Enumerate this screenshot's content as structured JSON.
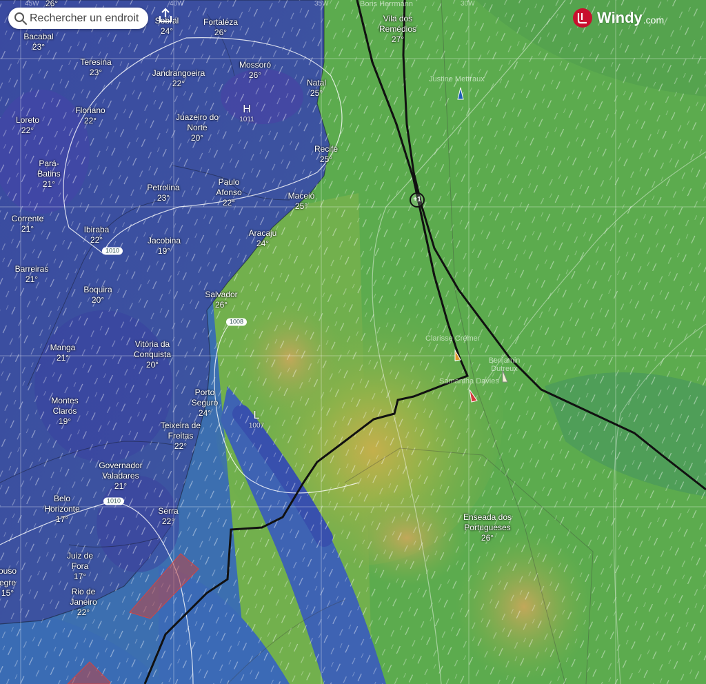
{
  "search": {
    "placeholder": "Rechercher un endroit",
    "icon": "search-icon"
  },
  "toolbar": {
    "share_icon": "share-icon"
  },
  "brand": {
    "name": "Windy",
    "domain": ".com",
    "color": "#c8102e"
  },
  "colors": {
    "ocean_calm": "#3c6fb0",
    "wind_moderate": "#5cab4e",
    "wind_strong": "#b8a94c",
    "land": "#3b4f98",
    "track": "#111111"
  },
  "grid_labels": [
    "45W",
    "40W",
    "35W",
    "30W"
  ],
  "cities": [
    {
      "name": "",
      "temp": "26°"
    },
    {
      "name": "Bacabal",
      "temp": "23°"
    },
    {
      "name": "Sobral",
      "temp": "24°"
    },
    {
      "name": "Fortaleza",
      "temp": "26°"
    },
    {
      "name": "Teresina",
      "temp": "23°"
    },
    {
      "name": "Jandrangoeira",
      "temp": "22°"
    },
    {
      "name": "Mossoró",
      "temp": "26°"
    },
    {
      "name": "Natal",
      "temp": "25°"
    },
    {
      "name": "Loreto",
      "temp": "22°"
    },
    {
      "name": "Floriano",
      "temp": "22°"
    },
    {
      "name": "Juazeiro do Norte",
      "temp": "20°"
    },
    {
      "name": "Recife",
      "temp": "25°"
    },
    {
      "name": "Pará- Batins",
      "temp": "21°"
    },
    {
      "name": "Petrolina",
      "temp": "23°"
    },
    {
      "name": "Paulo Afonso",
      "temp": "22°"
    },
    {
      "name": "Maceió",
      "temp": "25°"
    },
    {
      "name": "Corrente",
      "temp": "21°"
    },
    {
      "name": "Ibiraba",
      "temp": "22°"
    },
    {
      "name": "Jacobina",
      "temp": "19°"
    },
    {
      "name": "Aracaju",
      "temp": "24°"
    },
    {
      "name": "Barreiras",
      "temp": "21°"
    },
    {
      "name": "Boquira",
      "temp": "20°"
    },
    {
      "name": "Salvador",
      "temp": "26°"
    },
    {
      "name": "Manga",
      "temp": "21°"
    },
    {
      "name": "Vitória da Conquista",
      "temp": "20°"
    },
    {
      "name": "Montes Claros",
      "temp": "19°"
    },
    {
      "name": "Porto Seguro",
      "temp": "24°"
    },
    {
      "name": "Teixeira de Freitas",
      "temp": "22°"
    },
    {
      "name": "Governador Valadares",
      "temp": "21°"
    },
    {
      "name": "Belo Horizonte",
      "temp": "17°"
    },
    {
      "name": "Serra",
      "temp": "22°"
    },
    {
      "name": "Juiz de Fora",
      "temp": "17°"
    },
    {
      "name": "Rio de Janeiro",
      "temp": "22°"
    },
    {
      "name": "ouso",
      "temp": ""
    },
    {
      "name": "egre",
      "temp": "15°"
    },
    {
      "name": "Vila dos Remédios",
      "temp": "27°"
    },
    {
      "name": "Enseada dos Portugueses",
      "temp": "26°"
    }
  ],
  "pressure_centers": [
    {
      "symbol": "H",
      "value": "1011"
    },
    {
      "symbol": "L",
      "value": "1007"
    }
  ],
  "isobars": [
    "1010",
    "1008",
    "1010"
  ],
  "skippers": [
    "Boris Herrmann",
    "Justine Mettraux",
    "Clarisse Crémer",
    "Benjamin Dutreux",
    "Samantha Davies"
  ],
  "marker": {
    "label": "+1"
  }
}
